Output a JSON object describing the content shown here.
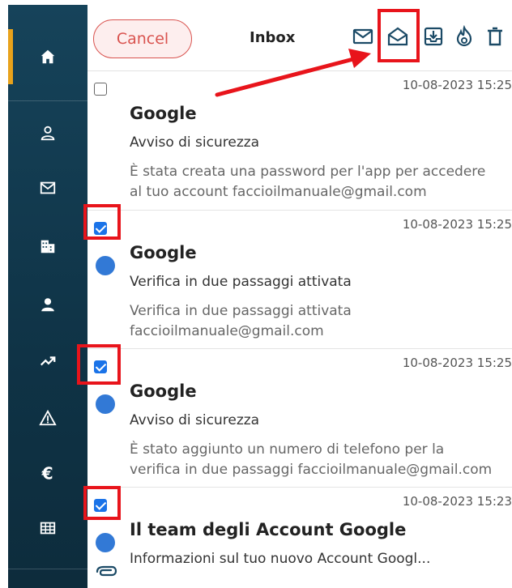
{
  "header": {
    "cancel_label": "Cancel",
    "title": "Inbox",
    "tools": [
      "mark-unread-icon",
      "mark-read-icon",
      "archive-icon",
      "fire-icon",
      "trash-icon"
    ]
  },
  "sidebar": {
    "items": [
      "home-icon",
      "profile-icon",
      "mail-icon",
      "buildings-icon",
      "user-icon",
      "trend-icon",
      "warning-icon",
      "euro-icon",
      "grid-icon"
    ],
    "accent_color": "#e8a21b"
  },
  "emails": [
    {
      "checked": false,
      "unread": false,
      "timestamp": "10-08-2023 15:25",
      "sender": "Google",
      "subject": "Avviso di sicurezza",
      "preview_line1": "È stata creata una password per l'app per accedere",
      "preview_line2": "al tuo account faccioilmanuale@gmail.com"
    },
    {
      "checked": true,
      "unread": true,
      "timestamp": "10-08-2023 15:25",
      "sender": "Google",
      "subject": "Verifica in due passaggi attivata",
      "preview_line1": "Verifica in due passaggi attivata",
      "preview_line2": "faccioilmanuale@gmail.com"
    },
    {
      "checked": true,
      "unread": true,
      "timestamp": "10-08-2023 15:25",
      "sender": "Google",
      "subject": "Avviso di sicurezza",
      "preview_line1": "È stato aggiunto un numero di telefono per la",
      "preview_line2": "verifica in due passaggi faccioilmanuale@gmail.com"
    },
    {
      "checked": true,
      "unread": true,
      "timestamp": "10-08-2023 15:23",
      "sender": "Il team degli Account Google",
      "subject": "Informazioni sul tuo nuovo Account Googl...",
      "preview_line1": "",
      "preview_line2": ""
    }
  ],
  "colors": {
    "highlight": "#e8141b",
    "checkbox": "#1a73e8",
    "unread_dot": "#3279d6",
    "cancel": "#d9534f"
  }
}
